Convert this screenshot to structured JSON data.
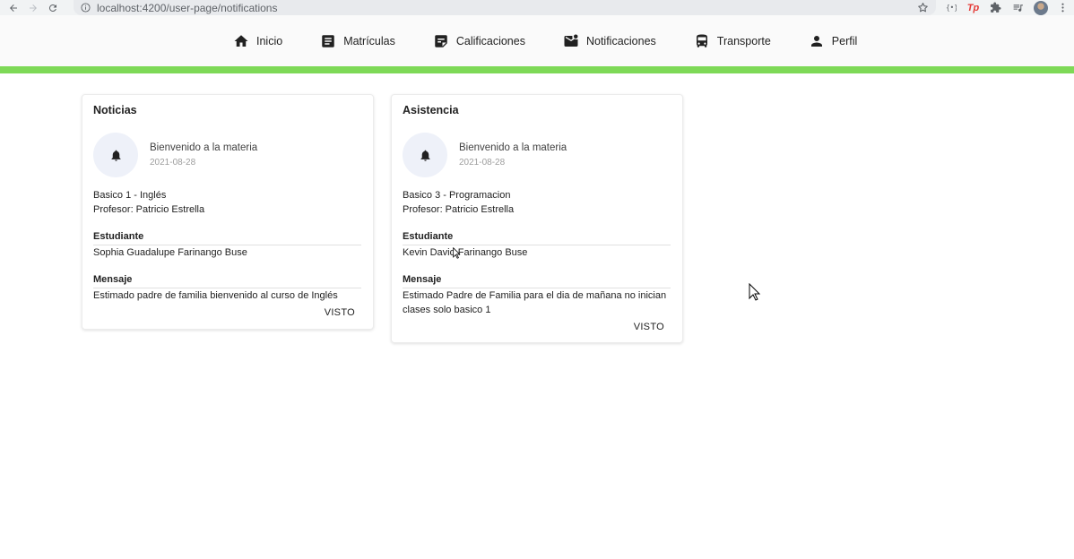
{
  "browser": {
    "url": "localhost:4200/user-page/notifications",
    "extension_tp_label": "Tp"
  },
  "nav": {
    "items": [
      {
        "label": "Inicio",
        "icon": "home-icon"
      },
      {
        "label": "Matrículas",
        "icon": "article-icon"
      },
      {
        "label": "Calificaciones",
        "icon": "grades-icon"
      },
      {
        "label": "Notificaciones",
        "icon": "mail-notification-icon"
      },
      {
        "label": "Transporte",
        "icon": "bus-icon"
      },
      {
        "label": "Perfil",
        "icon": "person-icon"
      }
    ]
  },
  "colors": {
    "accent_green": "#7ed957",
    "bell_circle": "#eef1f9"
  },
  "cards": [
    {
      "title": "Noticias",
      "notif_title": "Bienvenido a la materia",
      "date": "2021-08-28",
      "course": "Basico 1 - Inglés",
      "teacher": "Profesor: Patricio Estrella",
      "student_label": "Estudiante",
      "student": "Sophia Guadalupe Farinango Buse",
      "message_label": "Mensaje",
      "message": "Estimado padre de familia bienvenido al curso de Inglés",
      "action": "VISTO"
    },
    {
      "title": "Asistencia",
      "notif_title": "Bienvenido a la materia",
      "date": "2021-08-28",
      "course": "Basico 3 - Programacion",
      "teacher": "Profesor: Patricio Estrella",
      "student_label": "Estudiante",
      "student": "Kevin David Farinango Buse",
      "message_label": "Mensaje",
      "message": "Estimado Padre de Familia para el dia de mañana no inician clases solo basico 1",
      "action": "VISTO"
    }
  ]
}
